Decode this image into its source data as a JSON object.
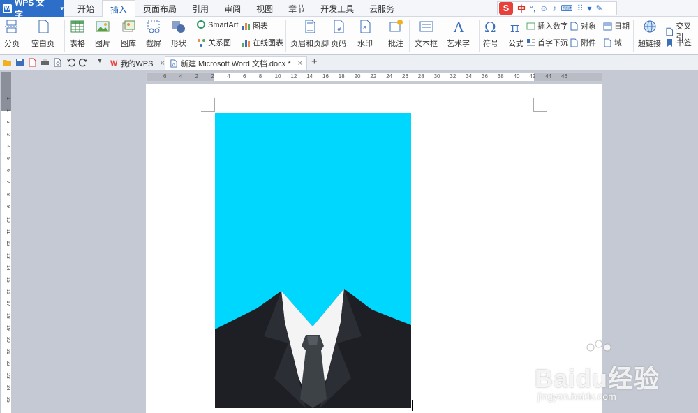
{
  "app": {
    "name": "WPS 文字",
    "logo": "W"
  },
  "menu": {
    "tabs": [
      "开始",
      "插入",
      "页面布局",
      "引用",
      "审阅",
      "视图",
      "章节",
      "开发工具",
      "云服务"
    ],
    "active_index": 1
  },
  "ime": {
    "logo": "S",
    "mode": "中",
    "punct": "°,"
  },
  "ribbon": {
    "page_break": "分页",
    "blank_page": "空白页",
    "table": "表格",
    "picture": "图片",
    "gallery": "图库",
    "screenshot": "截屏",
    "shapes": "形状",
    "smartart": "SmartArt",
    "chart": "图表",
    "relation": "关系图",
    "online_chart": "在线图表",
    "header_footer": "页眉和页脚",
    "page_number": "页码",
    "watermark": "水印",
    "comment": "批注",
    "textbox": "文本框",
    "wordart": "艺术字",
    "symbol": "符号",
    "formula": "公式",
    "insert_number": "插入数字",
    "object": "对象",
    "date": "日期",
    "dropcap": "首字下沉",
    "attachment": "附件",
    "field": "域",
    "hyperlink": "超链接",
    "cross_ref": "交叉引",
    "bookmark": "书签"
  },
  "doc_tabs": [
    {
      "label": "我的WPS",
      "close": "×"
    },
    {
      "label": "新建 Microsoft Word 文档.docx *",
      "close": "×"
    }
  ],
  "new_tab": "+",
  "ruler": {
    "h_numbers": [
      "6",
      "4",
      "2",
      "2",
      "4",
      "6",
      "8",
      "10",
      "12",
      "14",
      "16",
      "18",
      "20",
      "22",
      "24",
      "26",
      "28",
      "30",
      "32",
      "34",
      "36",
      "38",
      "40",
      "42",
      "44",
      "46"
    ],
    "v_numbers": [
      "1",
      "1",
      "2",
      "3",
      "4",
      "5",
      "6",
      "7",
      "8",
      "9",
      "10",
      "11",
      "12",
      "13",
      "14",
      "15",
      "16",
      "17",
      "18",
      "19",
      "20",
      "21",
      "22",
      "23",
      "24",
      "25"
    ],
    "corner": "L"
  },
  "photo": {
    "background_color": "#00d7ff",
    "suit_color": "#1d1f24",
    "tie_color": "#3d4247"
  },
  "watermark": {
    "brand": "Baidu经验",
    "url": "jingyan.baidu.com"
  },
  "colors": {
    "accent": "#2d6fc8",
    "active_tab_text": "#1a5fb4"
  }
}
